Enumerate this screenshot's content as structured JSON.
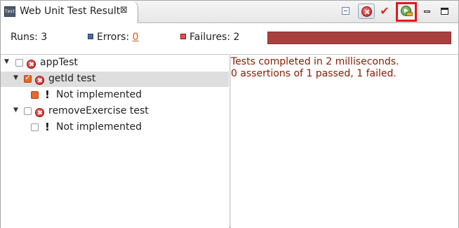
{
  "tab": {
    "title": "Web Unit Test Result",
    "close_glyph": "⊠",
    "icon_label": "Test"
  },
  "toolbar": {
    "collapse_icon": "collapse-all-icon",
    "stop_icon": "stop-icon",
    "check_glyph": "✔",
    "run_icon": "rerun-icon",
    "minimize_icon": "minimize-icon",
    "maximize_icon": "maximize-icon",
    "highlight_color": "#e8161b"
  },
  "counters": {
    "runs_label": "Runs:",
    "runs_value": "3",
    "errors_label": "Errors:",
    "errors_value": "0",
    "failures_label": "Failures:",
    "failures_value": "2",
    "progress_color": "#a94040",
    "progress_fraction": 1.0
  },
  "tree": [
    {
      "label": "appTest",
      "status": "error",
      "checked": false
    },
    {
      "label": "getId test",
      "status": "error",
      "checked": true,
      "selected": true
    },
    {
      "label": "Not implemented",
      "status": "not-implemented",
      "marker": "!"
    },
    {
      "label": "removeExercise test",
      "status": "error",
      "checked": false
    },
    {
      "label": "Not implemented",
      "status": "not-implemented",
      "marker": "!"
    }
  ],
  "details": {
    "line1": "Tests completed in 2 milliseconds.",
    "line2": "0 assertions of 1 passed, 1 failed."
  }
}
